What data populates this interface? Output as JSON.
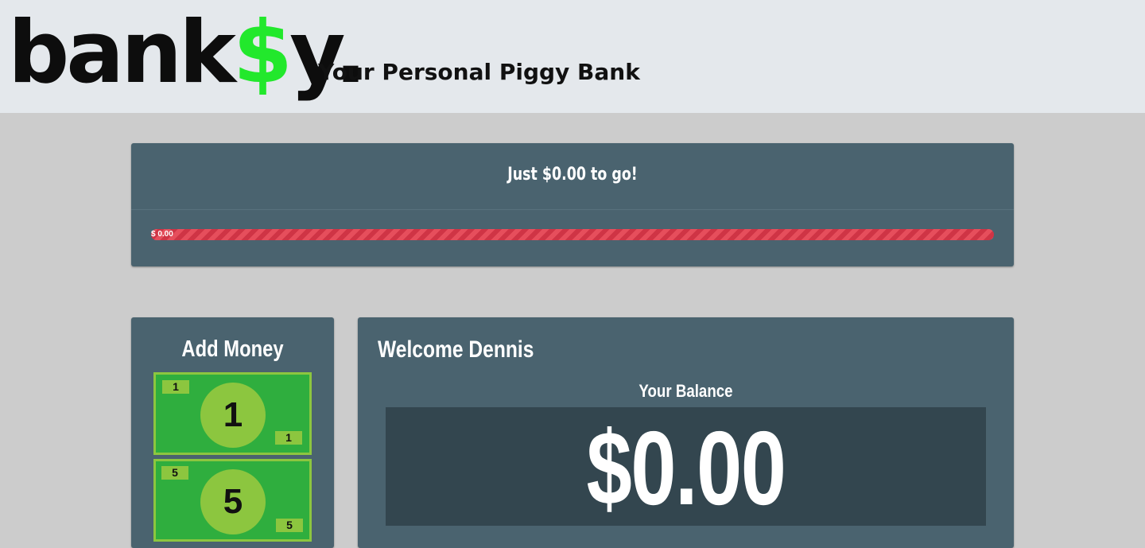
{
  "header": {
    "logo_prefix": "bank",
    "logo_dollar": "$",
    "logo_suffix": "y.",
    "tagline": "Your Personal Piggy Bank"
  },
  "goal": {
    "title": "Just $0.00 to go!",
    "progress_label": "$ 0.00",
    "progress_fraction": 1.0
  },
  "add_money": {
    "title": "Add Money",
    "bills": [
      {
        "value": "1"
      },
      {
        "value": "5"
      }
    ]
  },
  "welcome": {
    "title": "Welcome Dennis",
    "balance_label": "Your Balance",
    "balance_value": "$0.00"
  },
  "colors": {
    "header_bg": "#e4e8ec",
    "page_bg": "#cccccc",
    "panel_bg": "#4a636f",
    "balance_bg": "#33464f",
    "logo_dollar": "#22e82c",
    "progress_bar": "#d9404f",
    "bill_green": "#2fae3e",
    "bill_light": "#8cc63f"
  }
}
